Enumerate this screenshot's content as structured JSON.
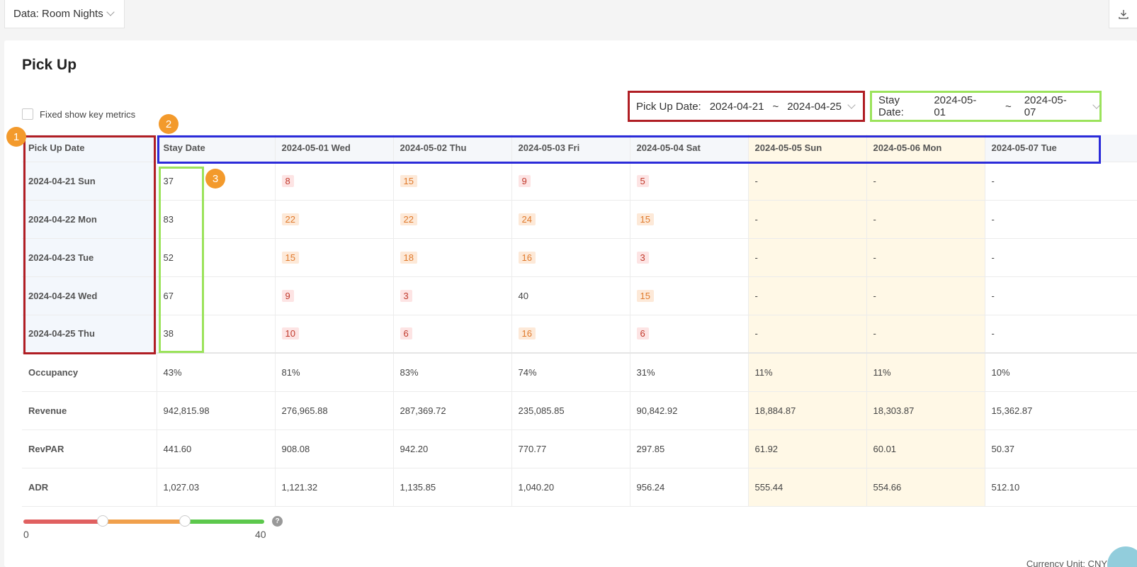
{
  "topbar": {
    "data_select": "Data: Room Nights",
    "download_icon": "download-icon"
  },
  "title": "Pick Up",
  "fixed_check_label": "Fixed show key metrics",
  "pickup_range": {
    "label": "Pick Up Date:",
    "start": "2024-04-21",
    "sep": "~",
    "end": "2024-04-25"
  },
  "stay_range": {
    "label": "Stay Date:",
    "start": "2024-05-01",
    "sep": "~",
    "end": "2024-05-07"
  },
  "table": {
    "corner": "Pick Up Date",
    "stay_header": "Stay Date",
    "columns": [
      "2024-05-01 Wed",
      "2024-05-02 Thu",
      "2024-05-03 Fri",
      "2024-05-04 Sat",
      "2024-05-05 Sun",
      "2024-05-06 Mon",
      "2024-05-07 Tue"
    ],
    "rows": [
      {
        "date": "2024-04-21 Sun",
        "total": "37",
        "cells": [
          "8",
          "15",
          "9",
          "5",
          "-",
          "-",
          "-"
        ]
      },
      {
        "date": "2024-04-22 Mon",
        "total": "83",
        "cells": [
          "22",
          "22",
          "24",
          "15",
          "-",
          "-",
          "-"
        ]
      },
      {
        "date": "2024-04-23 Tue",
        "total": "52",
        "cells": [
          "15",
          "18",
          "16",
          "3",
          "-",
          "-",
          "-"
        ]
      },
      {
        "date": "2024-04-24 Wed",
        "total": "67",
        "cells": [
          "9",
          "3",
          "40",
          "15",
          "-",
          "-",
          "-"
        ]
      },
      {
        "date": "2024-04-25 Thu",
        "total": "38",
        "cells": [
          "10",
          "6",
          "16",
          "6",
          "-",
          "-",
          "-"
        ]
      }
    ],
    "metrics": [
      {
        "label": "Occupancy",
        "values": [
          "43%",
          "81%",
          "83%",
          "74%",
          "31%",
          "11%",
          "11%",
          "10%"
        ]
      },
      {
        "label": "Revenue",
        "values": [
          "942,815.98",
          "276,965.88",
          "287,369.72",
          "235,085.85",
          "90,842.92",
          "18,884.87",
          "18,303.87",
          "15,362.87"
        ]
      },
      {
        "label": "RevPAR",
        "values": [
          "441.60",
          "908.08",
          "942.20",
          "770.77",
          "297.85",
          "61.92",
          "60.01",
          "50.37"
        ]
      },
      {
        "label": "ADR",
        "values": [
          "1,027.03",
          "1,121.32",
          "1,135.85",
          "1,040.20",
          "956.24",
          "555.44",
          "554.66",
          "512.10"
        ]
      }
    ]
  },
  "badges": [
    "1",
    "2",
    "3"
  ],
  "slider": {
    "min": "0",
    "max": "40",
    "low": 0.33,
    "high": 0.67
  },
  "currency": "Currency Unit: CNY",
  "colors": {
    "low": "#e06060",
    "mid": "#f0a04c",
    "high": "#5cc84c"
  }
}
